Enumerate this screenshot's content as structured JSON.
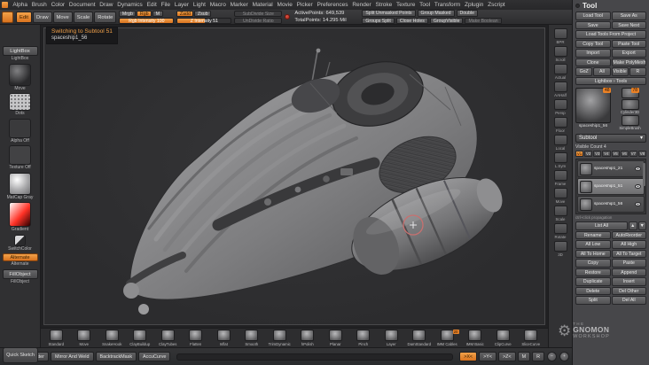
{
  "menubar": {
    "items": [
      "Alpha",
      "Brush",
      "Color",
      "Document",
      "Draw",
      "Dynamics",
      "Edit",
      "File",
      "Layer",
      "Light",
      "Macro",
      "Marker",
      "Material",
      "Movie",
      "Picker",
      "Preferences",
      "Render",
      "Stroke",
      "Texture",
      "Tool",
      "Transform",
      "Zplugin",
      "Zscript"
    ]
  },
  "shelf": {
    "mode_buttons": [
      {
        "label": "Edit",
        "active": true
      },
      {
        "label": "Draw"
      },
      {
        "label": "Move"
      },
      {
        "label": "Scale"
      },
      {
        "label": "Rotate"
      }
    ],
    "paint_buttons": [
      {
        "label": "Mrgb"
      },
      {
        "label": "Rgb",
        "active": true
      },
      {
        "label": "M"
      }
    ],
    "rgb_slider": {
      "label": "Rgb Intensity 100",
      "value_pct": 100
    },
    "sculpt_buttons": [
      {
        "label": "Zadd",
        "active": true
      },
      {
        "label": "Zsub"
      }
    ],
    "z_slider": {
      "label": "Z Intensity 51",
      "value_pct": 51
    },
    "disabled_sliders": [
      "SubDivide Size",
      "UnDivide Ratio"
    ],
    "status": {
      "active_points": "ActivePoints: 649,539",
      "total_points": "TotalPoints: 14.295 Mil",
      "row1": [
        {
          "label": "Split Unmasked Points"
        },
        {
          "label": "Group Masked"
        },
        {
          "label": "Double"
        }
      ],
      "row2": [
        {
          "label": "Groups Split"
        },
        {
          "label": "Close Holes"
        },
        {
          "label": "GroupVisible"
        },
        {
          "label": "Make Boolean",
          "disabled": true
        }
      ]
    }
  },
  "notification": {
    "line1": "Switching to Subtool 51",
    "line2": "spaceship1_56"
  },
  "sidebar": {
    "items": [
      {
        "kind": "button",
        "label": "LightBox"
      },
      {
        "kind": "sphere-dark",
        "label": "Move"
      },
      {
        "kind": "dots",
        "label": "Dots"
      },
      {
        "kind": "dark",
        "label": "Alpha Off"
      },
      {
        "kind": "dark2",
        "label": "Texture Off"
      },
      {
        "kind": "sphere-light",
        "label": "MatCap Gray"
      },
      {
        "kind": "color",
        "label": "Gradient"
      },
      {
        "kind": "swatch",
        "label": "SwitchColor"
      },
      {
        "kind": "orange",
        "label": "Alternate"
      },
      {
        "kind": "button",
        "label": "FillObject"
      }
    ],
    "bottom_label": "Quick Sketch"
  },
  "right_shelf": {
    "items": [
      {
        "label": "BPR"
      },
      {
        "label": "Scroll"
      },
      {
        "label": "Actual"
      },
      {
        "label": "AAHalf"
      },
      {
        "label": "Persp"
      },
      {
        "label": "Floor"
      },
      {
        "label": "Local"
      },
      {
        "label": "L.Sym"
      },
      {
        "label": "Frame"
      },
      {
        "label": "Move"
      },
      {
        "label": "Scale"
      },
      {
        "label": "Rotate"
      },
      {
        "label": "3D"
      }
    ]
  },
  "tool_panel": {
    "title": "Tool",
    "buttons": [
      {
        "label": "Load Tool",
        "w": "half"
      },
      {
        "label": "Save As",
        "w": "half"
      },
      {
        "label": "Save",
        "w": "half"
      },
      {
        "label": "Save Next",
        "w": "half"
      },
      {
        "label": "Load Tools From Project",
        "w": "full"
      },
      {
        "label": "Copy Tool",
        "w": "half"
      },
      {
        "label": "Paste Tool",
        "w": "half"
      },
      {
        "label": "Import",
        "w": "half"
      },
      {
        "label": "Export",
        "w": "half"
      },
      {
        "label": "Clone",
        "w": "half"
      },
      {
        "label": "Make PolyMesh3D",
        "w": "half"
      },
      {
        "label": "GoZ",
        "w": "q"
      },
      {
        "label": "All",
        "w": "q"
      },
      {
        "label": "Visible",
        "w": "q"
      },
      {
        "label": "R",
        "w": "q"
      },
      {
        "label": "Lightbox › Tools",
        "w": "full"
      }
    ],
    "active_tool": {
      "name": "spaceship1_56",
      "badge": "48"
    },
    "mini_tools": [
      {
        "badge": "78"
      },
      {
        "label": "Cylinder3D"
      },
      {
        "label": "SimpleBrush"
      }
    ],
    "subtool": {
      "title": "Subtool",
      "collapse_glyph": "▾",
      "visible_count": "Visible Count 4",
      "tabs": [
        {
          "label": "V1",
          "active": true
        },
        {
          "label": "V2"
        },
        {
          "label": "V3"
        },
        {
          "label": "V4"
        },
        {
          "label": "V5"
        },
        {
          "label": "V6"
        },
        {
          "label": "V7"
        },
        {
          "label": "V8"
        }
      ],
      "items": [
        {
          "name": "spaceship1_21"
        },
        {
          "name": "spaceship1_51",
          "selected": true
        },
        {
          "name": "spaceship1_56"
        }
      ],
      "note": "ctrl+click propagation",
      "buttons": [
        {
          "label": "List All",
          "w": "wide"
        },
        {
          "label": "▲",
          "w": "tiny"
        },
        {
          "label": "▼",
          "w": "tiny"
        },
        {
          "label": "Rename",
          "w": "half"
        },
        {
          "label": "AutoReorder",
          "w": "half"
        },
        {
          "label": "All Low",
          "w": "half"
        },
        {
          "label": "All High",
          "w": "half"
        },
        {
          "label": "All To Home",
          "w": "half"
        },
        {
          "label": "All To Target",
          "w": "half"
        },
        {
          "label": "Copy",
          "w": "half"
        },
        {
          "label": "Paste",
          "w": "half"
        },
        {
          "label": "Restore",
          "w": "half"
        },
        {
          "label": "Append",
          "w": "half"
        },
        {
          "label": "Duplicate",
          "w": "half"
        },
        {
          "label": "Insert",
          "w": "half"
        },
        {
          "label": "Delete",
          "w": "half"
        },
        {
          "label": "Del Other",
          "w": "half"
        },
        {
          "label": "Split",
          "w": "half"
        },
        {
          "label": "Del All",
          "w": "half"
        }
      ]
    }
  },
  "brushes": {
    "items": [
      {
        "name": "Standard"
      },
      {
        "name": "Move"
      },
      {
        "name": "SnakeHook"
      },
      {
        "name": "ClayBuildup"
      },
      {
        "name": "ClayTubes"
      },
      {
        "name": "Flatten"
      },
      {
        "name": "Inflat"
      },
      {
        "name": "Smooth"
      },
      {
        "name": "TrimDynamic"
      },
      {
        "name": "hPolish"
      },
      {
        "name": "Planar"
      },
      {
        "name": "Pinch"
      },
      {
        "name": "Layer"
      },
      {
        "name": "DamStandard"
      },
      {
        "name": "IMM Cables",
        "badge": "20"
      },
      {
        "name": "IMM Basic"
      },
      {
        "name": "ClipCurve"
      },
      {
        "name": "SliceCurve"
      }
    ]
  },
  "bottom_bar": {
    "left": [
      {
        "label": "Projection Master"
      },
      {
        "label": "Mirror And Weld"
      },
      {
        "label": "BacktrackMask"
      },
      {
        "label": "AccuCurve"
      }
    ],
    "right": [
      {
        "label": ">X<",
        "active": true
      },
      {
        "label": ">Y<"
      },
      {
        "label": ">Z<"
      },
      {
        "label": "M"
      },
      {
        "label": "R"
      }
    ]
  },
  "watermark": {
    "line1": "THE",
    "line2": "GNOMON",
    "line3": "WORKSHOP",
    "gear": "⚙"
  },
  "colors": {
    "accent": "#e98126",
    "cursor": "#c8706f",
    "canvas_bg": "#2e2e30"
  }
}
